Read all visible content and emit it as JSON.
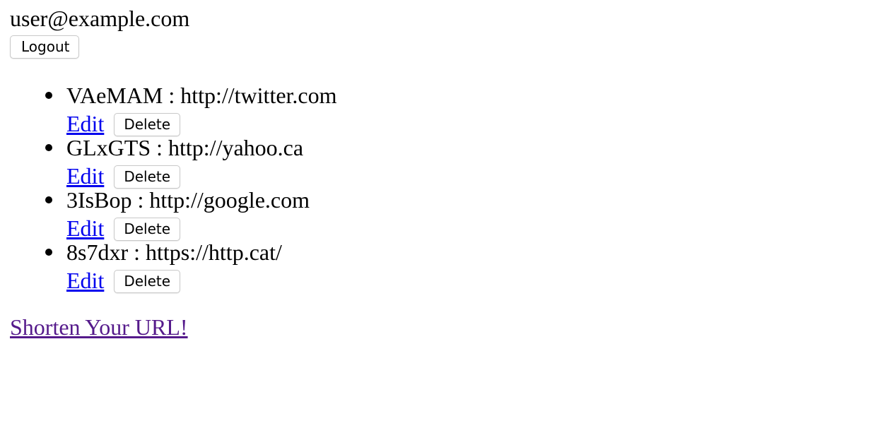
{
  "header": {
    "user_email": "user@example.com",
    "logout_label": "Logout"
  },
  "urls": [
    {
      "short": "VAeMAM",
      "long": "http://twitter.com",
      "edit_label": "Edit",
      "delete_label": "Delete"
    },
    {
      "short": "GLxGTS",
      "long": "http://yahoo.ca",
      "edit_label": "Edit",
      "delete_label": "Delete"
    },
    {
      "short": "3IsBop",
      "long": "http://google.com",
      "edit_label": "Edit",
      "delete_label": "Delete"
    },
    {
      "short": "8s7dxr",
      "long": "https://http.cat/",
      "edit_label": "Edit",
      "delete_label": "Delete"
    }
  ],
  "separator": " : ",
  "footer": {
    "shorten_link_label": "Shorten Your URL!"
  },
  "colors": {
    "link": "#0000ee",
    "visited_link": "#551a8b"
  }
}
